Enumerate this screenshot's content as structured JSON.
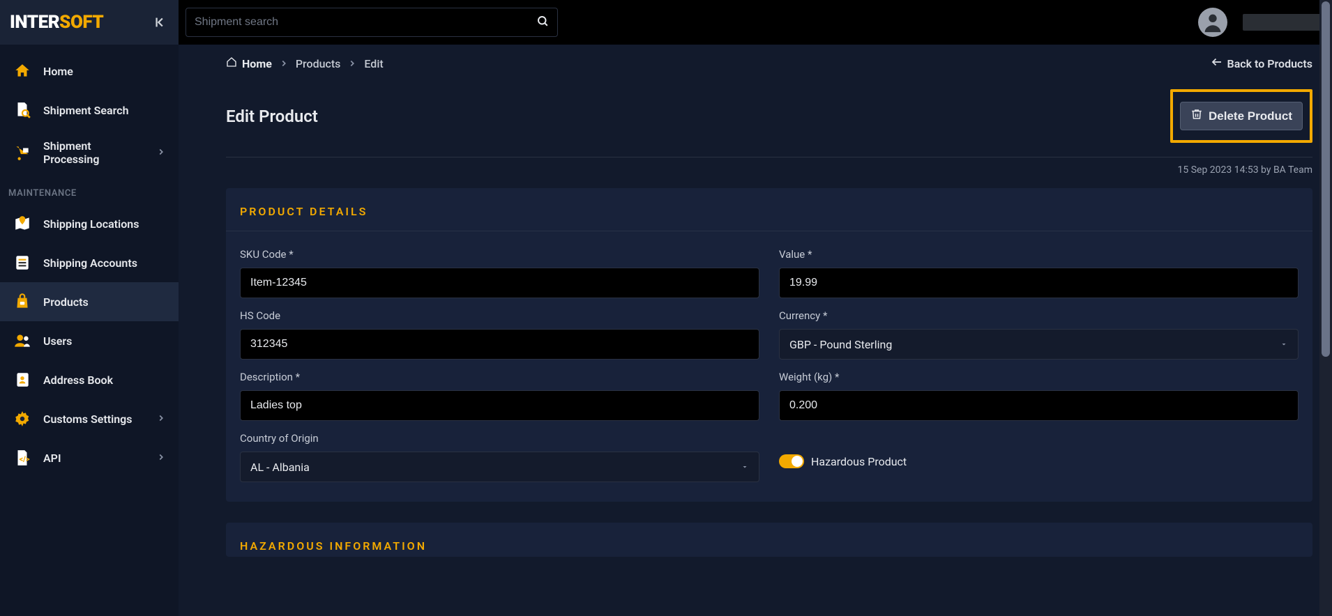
{
  "brand": {
    "part1": "INTER",
    "part2": "SOFT"
  },
  "search": {
    "placeholder": "Shipment search"
  },
  "sidebar": {
    "items_top": [
      {
        "label": "Home"
      },
      {
        "label": "Shipment Search"
      },
      {
        "label": "Shipment Processing",
        "has_chevron": true
      }
    ],
    "section_label": "MAINTENANCE",
    "items_maint": [
      {
        "label": "Shipping Locations"
      },
      {
        "label": "Shipping Accounts"
      },
      {
        "label": "Products",
        "active": true
      },
      {
        "label": "Users"
      },
      {
        "label": "Address Book"
      },
      {
        "label": "Customs Settings",
        "has_chevron": true
      },
      {
        "label": "API",
        "has_chevron": true
      }
    ]
  },
  "breadcrumb": {
    "home": "Home",
    "mid": "Products",
    "current": "Edit",
    "back": "Back to Products"
  },
  "page": {
    "title": "Edit Product",
    "delete_label": "Delete Product",
    "meta": "15 Sep 2023 14:53 by BA Team"
  },
  "panels": {
    "details_title": "PRODUCT DETAILS",
    "hazard_title": "HAZARDOUS INFORMATION"
  },
  "form": {
    "sku": {
      "label": "SKU Code *",
      "value": "Item-12345"
    },
    "value": {
      "label": "Value *",
      "value": "19.99"
    },
    "hs": {
      "label": "HS Code",
      "value": "312345"
    },
    "currency": {
      "label": "Currency *",
      "value": "GBP - Pound Sterling"
    },
    "description": {
      "label": "Description *",
      "value": "Ladies top"
    },
    "weight": {
      "label": "Weight (kg) *",
      "value": "0.200"
    },
    "origin": {
      "label": "Country of Origin",
      "value": "AL - Albania"
    },
    "hazard_toggle": {
      "label": "Hazardous Product",
      "on": true
    }
  }
}
